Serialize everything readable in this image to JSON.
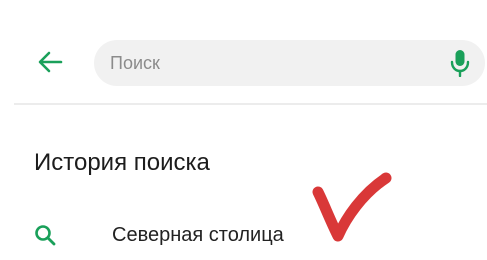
{
  "search": {
    "placeholder": "Поиск",
    "value": ""
  },
  "history": {
    "title": "История поиска",
    "items": [
      {
        "label": "Северная столица"
      }
    ]
  },
  "icons": {
    "back": "arrow-left-icon",
    "mic": "microphone-icon",
    "history_item": "search-icon",
    "annotation": "check-mark-icon"
  },
  "colors": {
    "accent": "#1aa05a",
    "field_background": "#f1f1f1",
    "annotation": "#d93838"
  }
}
